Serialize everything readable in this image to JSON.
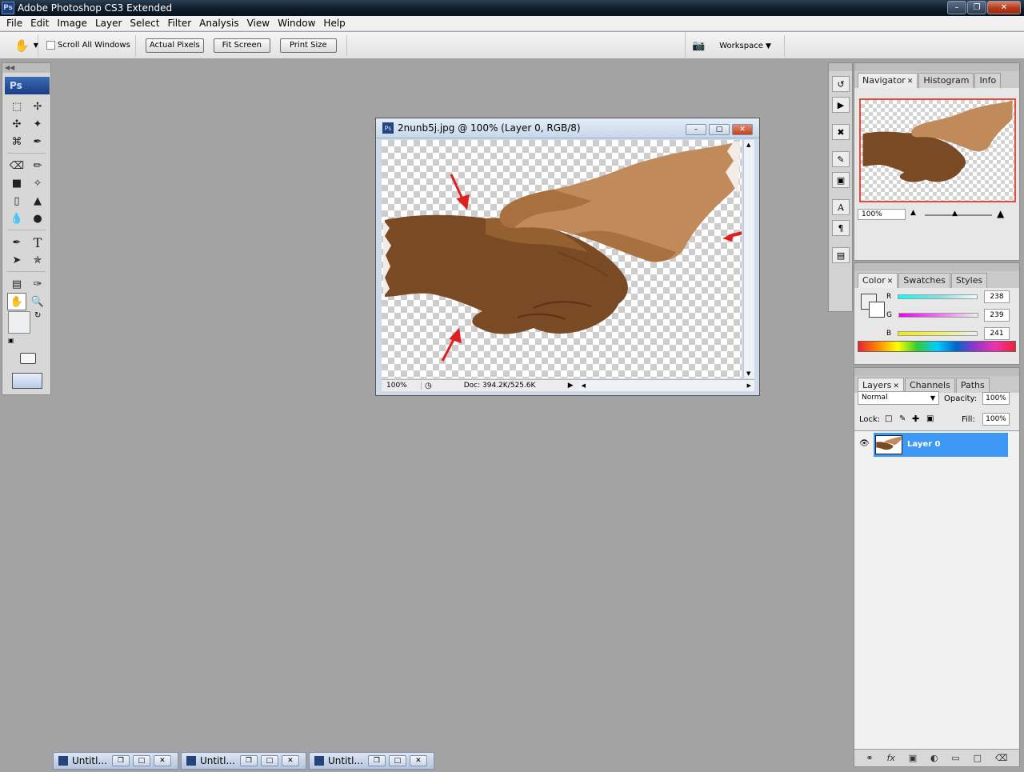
{
  "window": {
    "title": "Adobe Photoshop CS3 Extended",
    "app_icon": "Ps"
  },
  "menubar": [
    "File",
    "Edit",
    "Image",
    "Layer",
    "Select",
    "Filter",
    "Analysis",
    "View",
    "Window",
    "Help"
  ],
  "options": {
    "scroll_all_windows": "Scroll All Windows",
    "actual_pixels": "Actual Pixels",
    "fit_screen": "Fit Screen",
    "print_size": "Print Size",
    "workspace": "Workspace"
  },
  "toolbox": {
    "logo": "Ps"
  },
  "document": {
    "title": "2nunb5j.jpg @ 100% (Layer 0, RGB/8)",
    "zoom": "100%",
    "doc_size": "Doc: 394.2K/525.6K"
  },
  "navigator": {
    "tabs": [
      "Navigator",
      "Histogram",
      "Info"
    ],
    "zoom": "100%"
  },
  "color_panel": {
    "tabs": [
      "Color",
      "Swatches",
      "Styles"
    ],
    "channels": [
      {
        "label": "R",
        "value": "238",
        "fraction": 0.933,
        "gradient": "#7fe0e0"
      },
      {
        "label": "G",
        "value": "239",
        "fraction": 0.937,
        "gradient": "#f070f0"
      },
      {
        "label": "B",
        "value": "241",
        "fraction": 0.945,
        "gradient": "#f0f060"
      }
    ]
  },
  "layers_panel": {
    "tabs": [
      "Layers",
      "Channels",
      "Paths"
    ],
    "blend_mode": "Normal",
    "opacity_label": "Opacity:",
    "opacity": "100%",
    "lock_label": "Lock:",
    "fill_label": "Fill:",
    "fill": "100%",
    "layers": [
      {
        "name": "Layer 0",
        "visible": true,
        "selected": true
      }
    ],
    "footer_icons": [
      "link-icon",
      "fx-icon",
      "mask-icon",
      "adjustment-icon",
      "folder-icon",
      "new-layer-icon",
      "trash-icon"
    ]
  },
  "minimized_docs": [
    "Untitl...",
    "Untitl...",
    "Untitl..."
  ],
  "colors": {
    "accent_selection": "#3d97f5",
    "nav_box": "#e24c3e",
    "arrow": "#e02020"
  }
}
